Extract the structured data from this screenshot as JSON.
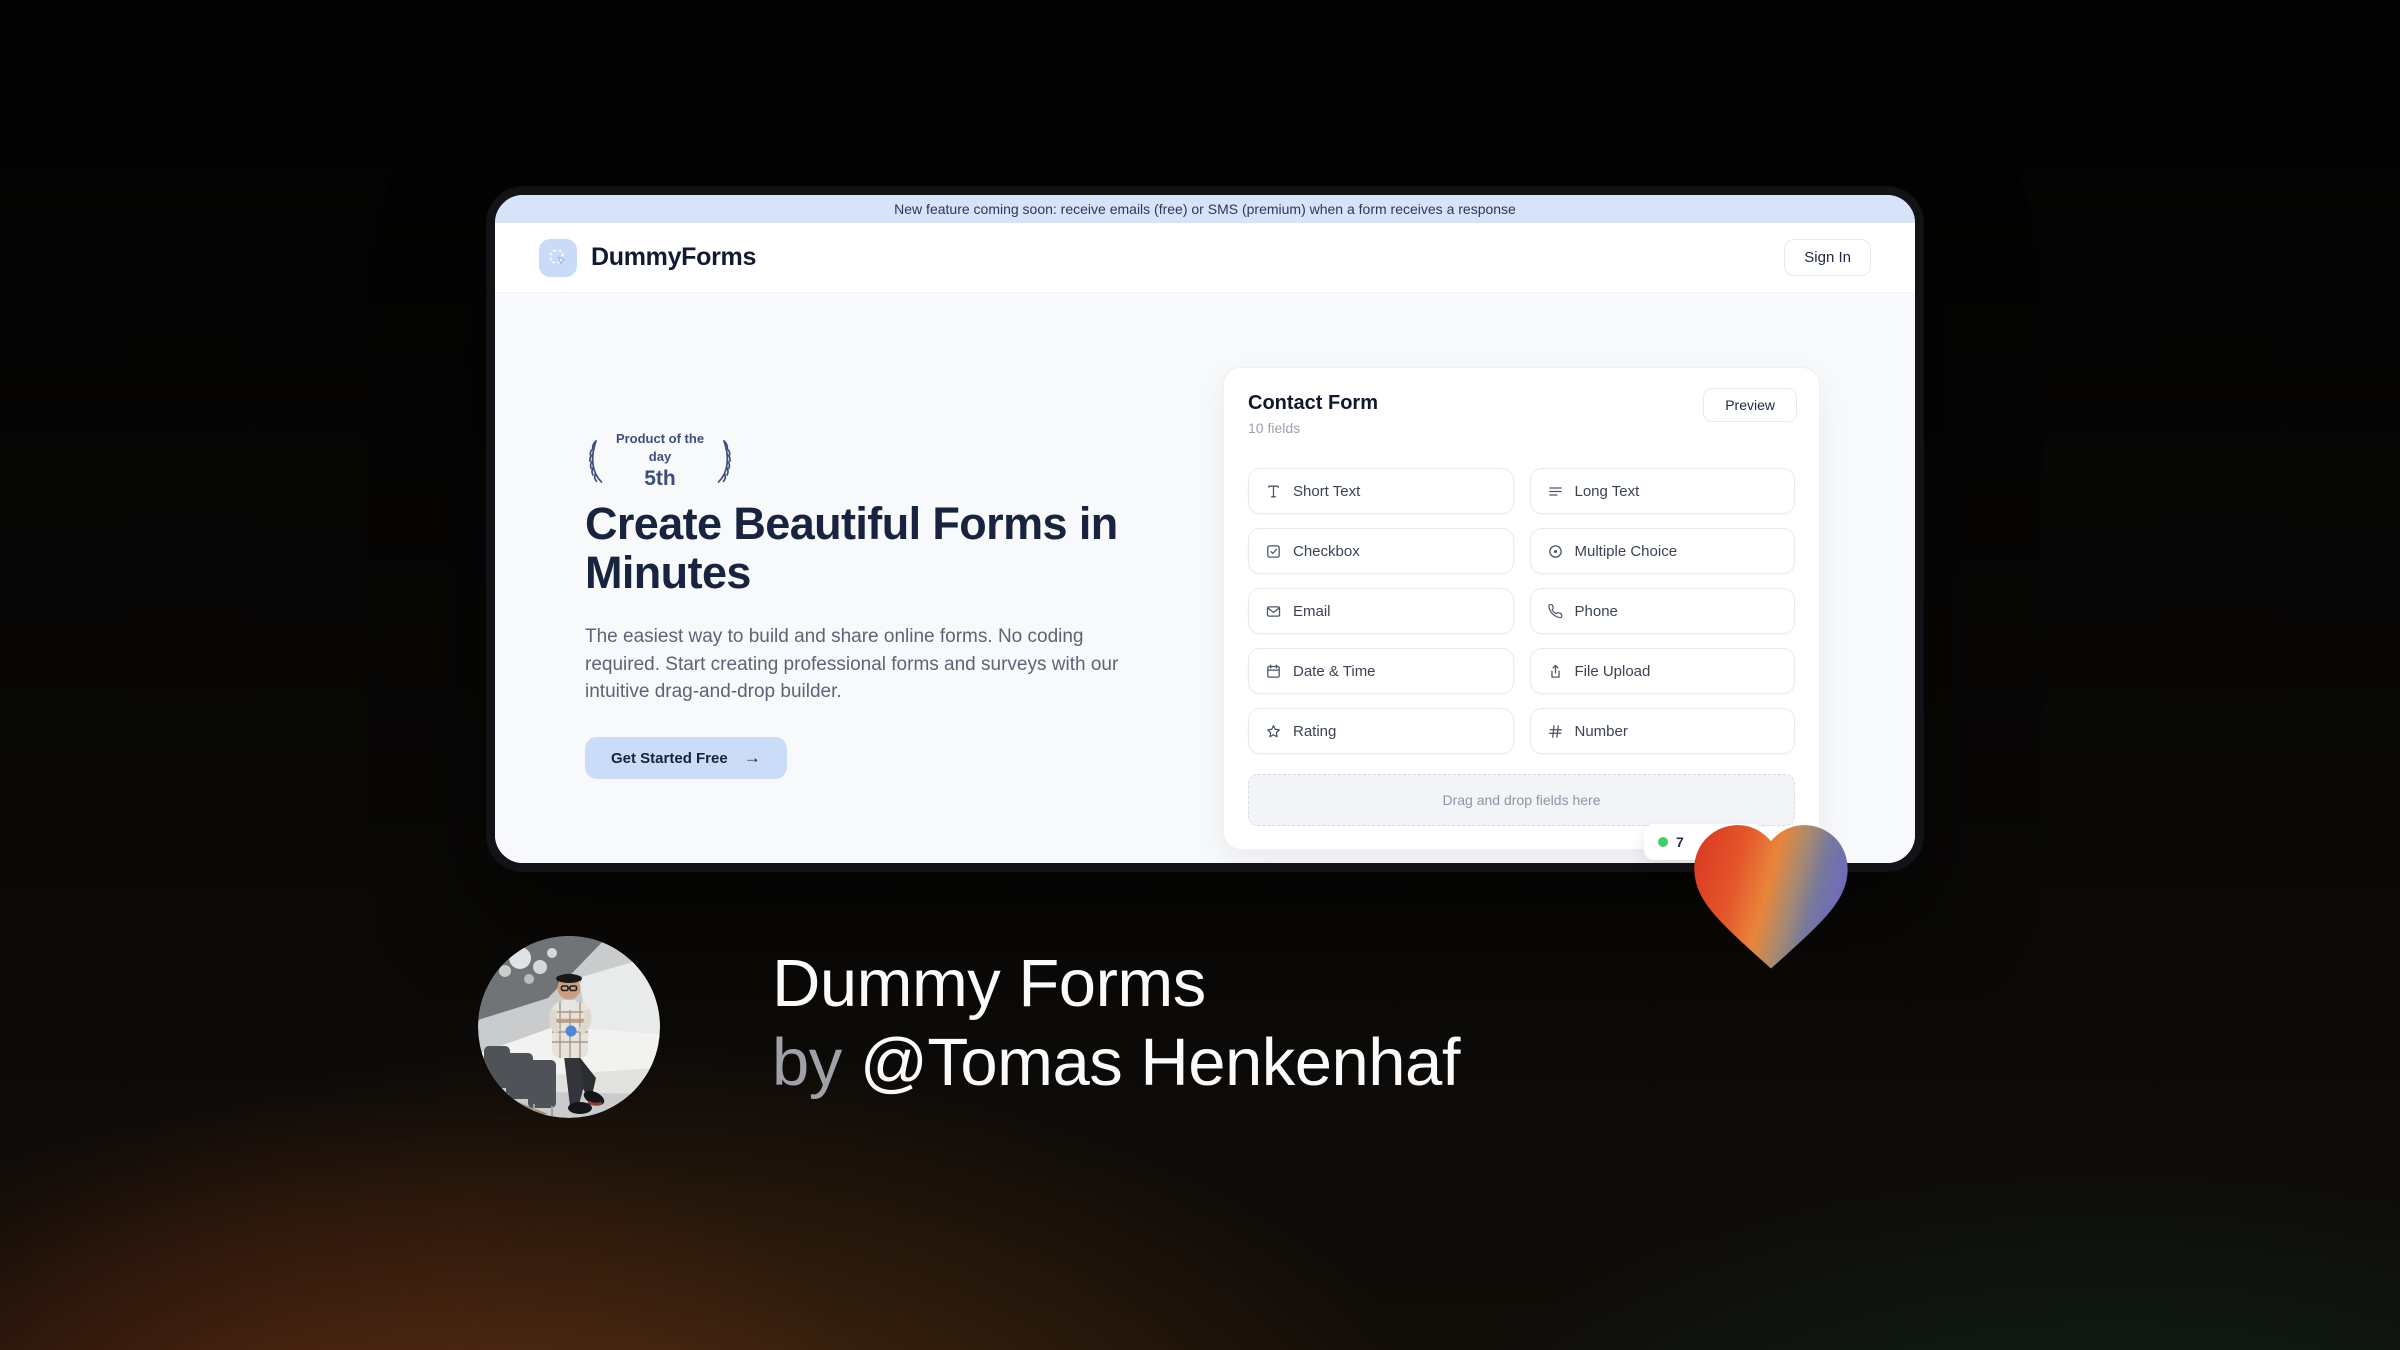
{
  "banner": {
    "text": "New feature coming soon: receive emails (free) or SMS (premium) when a form receives a response"
  },
  "header": {
    "brand": "DummyForms",
    "logo_icon": "dashed-selection-cursor-icon",
    "sign_in_label": "Sign In"
  },
  "hero": {
    "award_badge": {
      "icon": "laurel-wreath-icon",
      "line1": "Product of the day",
      "line2": "5th"
    },
    "title_line1": "Create Beautiful Forms in",
    "title_line2": "Minutes",
    "description": "The easiest way to build and share online forms. No coding required. Start creating professional forms and surveys with our intuitive drag-and-drop builder.",
    "cta": {
      "label": "Get Started Free",
      "arrow": "→"
    }
  },
  "form_builder": {
    "title": "Contact Form",
    "field_count": "10 fields",
    "preview_label": "Preview",
    "fields": [
      {
        "label": "Short Text",
        "icon": "type-icon"
      },
      {
        "label": "Long Text",
        "icon": "align-left-icon"
      },
      {
        "label": "Checkbox",
        "icon": "checkbox-icon"
      },
      {
        "label": "Multiple Choice",
        "icon": "radio-circle-icon"
      },
      {
        "label": "Email",
        "icon": "mail-icon"
      },
      {
        "label": "Phone",
        "icon": "phone-icon"
      },
      {
        "label": "Date & Time",
        "icon": "calendar-icon"
      },
      {
        "label": "File Upload",
        "icon": "upload-icon"
      },
      {
        "label": "Rating",
        "icon": "star-icon"
      },
      {
        "label": "Number",
        "icon": "hash-icon"
      }
    ],
    "dropzone_text": "Drag and drop fields here",
    "response_badge": {
      "visible_text": "7",
      "dot_color": "#3ecf6a"
    }
  },
  "caption": {
    "line1": "Dummy Forms",
    "line2_prefix": "by ",
    "line2_name": "@Tomas Henkenhaf"
  },
  "decor": {
    "heart_icon": "gradient-heart-icon",
    "avatar": "author-photo"
  },
  "colors": {
    "banner_blue": "#d7e3f8",
    "accent_blue": "#cbdcf8",
    "navy": "#18233f",
    "page_bg": "#f7f9fb",
    "badge_dot_green": "#3ecf6a",
    "heart_gradient": [
      "#da3b23",
      "#e9853a",
      "#6d68c2"
    ]
  }
}
